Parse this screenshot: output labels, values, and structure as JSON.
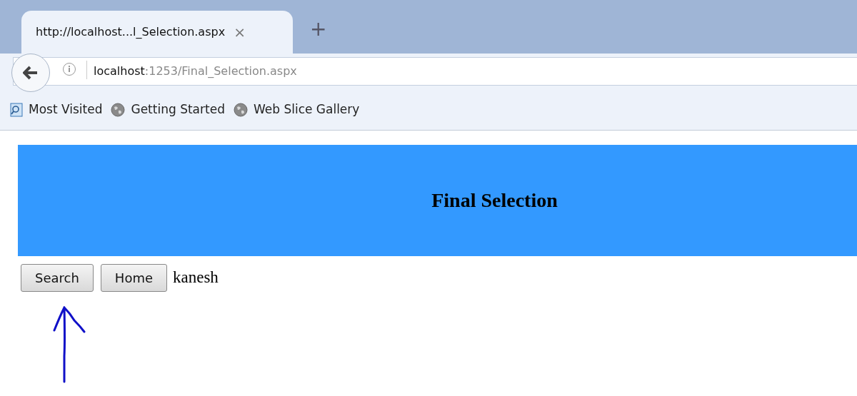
{
  "tab": {
    "title": "http://localhost...l_Selection.aspx",
    "close": "×",
    "new_tab": "+",
    "selected": true
  },
  "address_bar": {
    "host": "localhost",
    "path": ":1253/Final_Selection.aspx"
  },
  "bookmarks": [
    {
      "label": "Most Visited",
      "kind": "search"
    },
    {
      "label": "Getting Started",
      "kind": "globe"
    },
    {
      "label": "Web Slice Gallery",
      "kind": "globe"
    }
  ],
  "page": {
    "header": "Final Selection",
    "buttons": [
      "Search",
      "Home"
    ],
    "user": "kanesh"
  }
}
